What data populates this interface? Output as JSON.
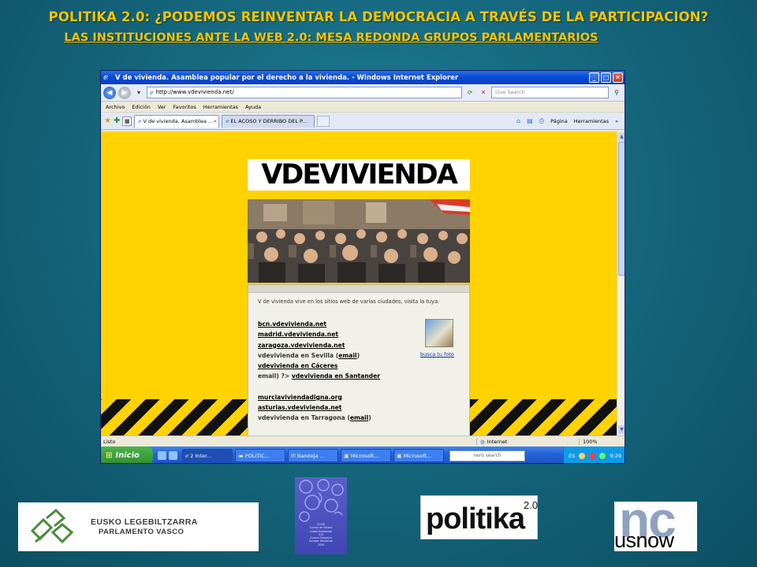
{
  "slide": {
    "title": "POLITIKA 2.0: ¿PODEMOS REINVENTAR LA DEMOCRACIA A TRAVÉS DE LA PARTICIPACION?",
    "subtitle": "LAS INSTITUCIONES ANTE LA WEB 2.0: MESA REDONDA GRUPOS PARLAMENTARIOS",
    "colors": {
      "title": "#f5c400",
      "background": "#15687e"
    }
  },
  "browser": {
    "window_title": "V de vivienda. Asamblea popular por el derecho a la vivienda. - Windows Internet Explorer",
    "address": "http://www.vdevivienda.net/",
    "search_placeholder": "Live Search",
    "menu": [
      "Archivo",
      "Edición",
      "Ver",
      "Favoritos",
      "Herramientas",
      "Ayuda"
    ],
    "tabs": [
      {
        "label": "V de vivienda. Asamblea ..."
      },
      {
        "label": "EL ACOSO Y DERRIBO DEL P..."
      }
    ],
    "command_bar": {
      "page": "Página",
      "tools": "Herramientas"
    },
    "status": {
      "text": "Listo",
      "zone": "Internet",
      "zoom": "100%"
    }
  },
  "website": {
    "logo": "VDEVIVIENDA",
    "intro": "V de vivienda vive en los sitios web de varias ciudades, visita la tuya:",
    "cities": [
      {
        "parts": [
          {
            "text": "bcn.vdevivienda.net",
            "link": true
          }
        ]
      },
      {
        "parts": [
          {
            "text": "madrid.vdevivienda.net",
            "link": true
          }
        ]
      },
      {
        "parts": [
          {
            "text": "zaragoza.vdevivienda.net",
            "link": true
          }
        ]
      },
      {
        "parts": [
          {
            "text": "vdevivienda en Sevilla (",
            "link": false
          },
          {
            "text": "email",
            "link": true
          },
          {
            "text": ")",
            "link": false
          }
        ]
      },
      {
        "parts": [
          {
            "text": "vdevivienda en Cáceres",
            "link": true
          }
        ]
      },
      {
        "parts": [
          {
            "text": "email) ?> ",
            "link": false
          },
          {
            "text": "vdevivienda en Santander",
            "link": true
          }
        ]
      },
      {
        "gap": true
      },
      {
        "parts": [
          {
            "text": "murciaviviendadigna.org",
            "link": true
          }
        ]
      },
      {
        "parts": [
          {
            "text": "asturias.vdevivienda.net",
            "link": true
          }
        ]
      },
      {
        "parts": [
          {
            "text": "vdevivienda en Tarragona (",
            "link": false
          },
          {
            "text": "email",
            "link": true
          },
          {
            "text": ")",
            "link": false
          }
        ]
      }
    ],
    "photo_caption": "busca tu foto",
    "colors": {
      "background": "#ffd200",
      "stripe": "#111111"
    }
  },
  "taskbar": {
    "start": "Inicio",
    "items": [
      "2 Inter...",
      "POLITIC...",
      "Bandeja ...",
      "Microsoft...",
      "Microsoft..."
    ],
    "deskbar": "nero search",
    "lang": "ES",
    "clock": "9:29"
  },
  "logos": {
    "eusko_line1": "EUSKO LEGEBILTZARRA",
    "eusko_line2": "PARLAMENTO VASCO",
    "politika_word": "politika",
    "politika_version": "2.0",
    "nc_mark": "nc",
    "nc_word": "usnow",
    "book_lines": [
      "XXVIII",
      "Cursos de Verano",
      "Udako Ikastaroak",
      "XXI",
      "Cursos Europeos",
      "Europar Ikastaroak",
      "2009"
    ]
  }
}
